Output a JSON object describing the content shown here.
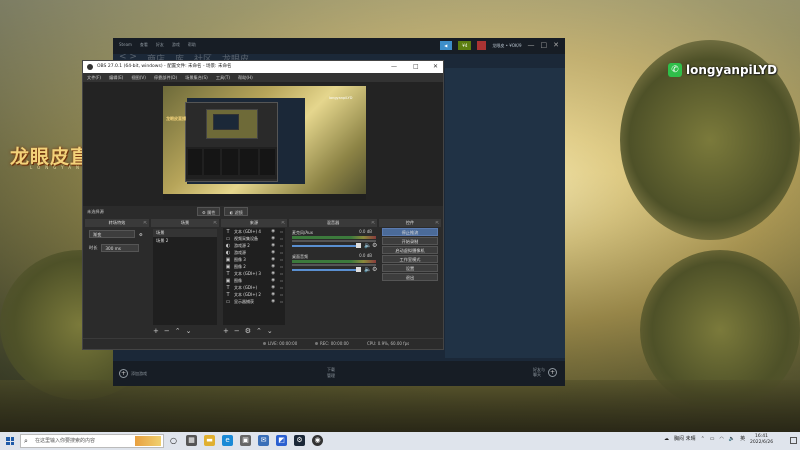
{
  "desktop": {
    "streamer_logo": "龙眼皮直播",
    "streamer_logo_sub": "LONGYANPI",
    "watermark_icon": "wechat-icon",
    "watermark_text": "longyanpiLYD"
  },
  "steam": {
    "menu": [
      "Steam",
      "查看",
      "好友",
      "游戏",
      "帮助"
    ],
    "nav": [
      "< >",
      "商店",
      "库",
      "社区",
      "龙眼皮"
    ],
    "top_buttons": {
      "broadcast": "◀",
      "wallet": "¥4",
      "username": "龙眼皮 • ¥OK/9"
    },
    "bottom": {
      "add_game": "添加游戏",
      "downloads_line1": "下载",
      "downloads_line2": "管理",
      "friends_line1": "好友与",
      "friends_line2": "聊天"
    }
  },
  "obs": {
    "title": "OBS 27.0.1 (64-bit, windows) - 配置文件: 未命名 - 场景: 未命名",
    "window_controls": [
      "—",
      "□",
      "✕"
    ],
    "menu": [
      "文件(F)",
      "编辑(E)",
      "视图(V)",
      "停靠部件(D)",
      "场景集合(S)",
      "工具(T)",
      "帮助(H)"
    ],
    "preview": {
      "logo": "龙眼皮直播",
      "watermark": "longyanpiLYD"
    },
    "scene_label": "未选择源",
    "mid_buttons": [
      "⚙ 属性",
      "◐ 滤镜"
    ],
    "docks": {
      "transitions": {
        "title": "转场特效",
        "select": "渐变",
        "duration_label": "时长",
        "duration_value": "300 ms"
      },
      "scenes": {
        "title": "场景",
        "items": [
          "场景",
          "场景 2"
        ]
      },
      "sources": {
        "title": "来源",
        "items": [
          {
            "icon": "T",
            "label": "文本 (GDI+) 4"
          },
          {
            "icon": "▭",
            "label": "视频采集设备"
          },
          {
            "icon": "◐",
            "label": "游戏源 2"
          },
          {
            "icon": "◐",
            "label": "游戏源"
          },
          {
            "icon": "▣",
            "label": "图像 3"
          },
          {
            "icon": "▣",
            "label": "图像 2"
          },
          {
            "icon": "T",
            "label": "文本 (GDI+) 3"
          },
          {
            "icon": "▣",
            "label": "图像"
          },
          {
            "icon": "T",
            "label": "文本 (GDI+)"
          },
          {
            "icon": "T",
            "label": "文本 (GDI+) 2"
          },
          {
            "icon": "▭",
            "label": "显示器捕获"
          }
        ]
      },
      "mixer": {
        "title": "混音器",
        "channels": [
          {
            "name": "麦克风/Aux",
            "db": "0.0 dB"
          },
          {
            "name": "桌面音频",
            "db": "0.0 dB"
          }
        ]
      },
      "controls": {
        "title": "控件",
        "buttons": [
          "停止推流",
          "开始录制",
          "启动虚拟摄像机",
          "工作室模式",
          "设置",
          "退出"
        ]
      }
    },
    "status": {
      "live": "LIVE: 00:00:00",
      "rec": "REC: 00:00:00",
      "cpu": "CPU: 0.9%, 60.00 fps"
    }
  },
  "taskbar": {
    "search_placeholder": "在这里输入你要搜索的内容",
    "tray_text": "胸闷 未晴",
    "tray_lang": "英",
    "time": "16:41",
    "date": "2022/6/26"
  },
  "colors": {
    "steam_bg": "#1b2838",
    "obs_bg": "#2b2b2b",
    "obs_active": "#4b6b99",
    "taskbar": "#dfe4ec"
  }
}
